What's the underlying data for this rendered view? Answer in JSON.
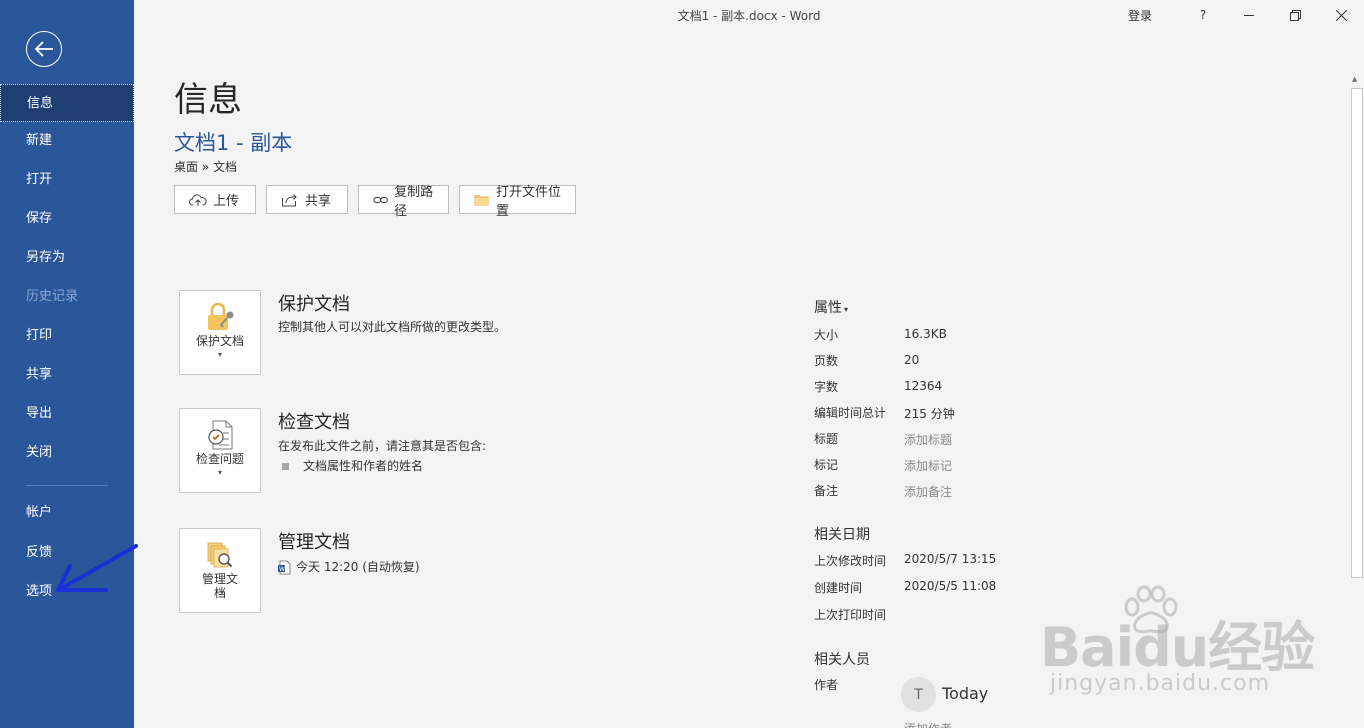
{
  "window": {
    "title": "文档1 - 副本.docx  -  Word",
    "signin": "登录",
    "help": "?",
    "minimize_icon": "minimize-icon",
    "restore_icon": "restore-icon",
    "close_icon": "close-icon"
  },
  "sidebar": {
    "items": [
      {
        "label": "信息",
        "state": "active"
      },
      {
        "label": "新建"
      },
      {
        "label": "打开"
      },
      {
        "label": "保存"
      },
      {
        "label": "另存为"
      },
      {
        "label": "历史记录",
        "state": "disabled"
      },
      {
        "label": "打印"
      },
      {
        "label": "共享"
      },
      {
        "label": "导出"
      },
      {
        "label": "关闭"
      },
      {
        "label": "帐户"
      },
      {
        "label": "反馈"
      },
      {
        "label": "选项"
      }
    ]
  },
  "main": {
    "page_title": "信息",
    "doc_name": "文档1 - 副本",
    "breadcrumb": "桌面 » 文档",
    "actions": [
      "上传",
      "共享",
      "复制路径",
      "打开文件位置"
    ]
  },
  "sections": {
    "protect": {
      "card_label": "保护文档",
      "title": "保护文档",
      "desc": "控制其他人可以对此文档所做的更改类型。"
    },
    "inspect": {
      "card_label": "检查问题",
      "title": "检查文档",
      "desc": "在发布此文件之前，请注意其是否包含:",
      "bullet": "文档属性和作者的姓名"
    },
    "manage": {
      "card_label": "管理文档",
      "title": "管理文档",
      "version": "今天 12:20 (自动恢复)"
    }
  },
  "properties": {
    "header": "属性",
    "rows": [
      {
        "label": "大小",
        "value": "16.3KB"
      },
      {
        "label": "页数",
        "value": "20"
      },
      {
        "label": "字数",
        "value": "12364"
      },
      {
        "label": "编辑时间总计",
        "value": "215 分钟"
      },
      {
        "label": "标题",
        "value": "添加标题"
      },
      {
        "label": "标记",
        "value": "添加标记"
      },
      {
        "label": "备注",
        "value": "添加备注"
      }
    ],
    "dates_header": "相关日期",
    "dates": [
      {
        "label": "上次修改时间",
        "value": "2020/5/7 13:15"
      },
      {
        "label": "创建时间",
        "value": "2020/5/5 11:08"
      },
      {
        "label": "上次打印时间",
        "value": ""
      }
    ],
    "people_header": "相关人员",
    "author_label": "作者",
    "author_initial": "T",
    "author_name": "Today",
    "add_author": "添加作者"
  },
  "watermark": {
    "text": "Baidu经验",
    "url": "jingyan.baidu.com"
  },
  "colors": {
    "sidebar": "#2b579a",
    "accent": "#2b579a",
    "annotation": "#1a2fd6"
  }
}
